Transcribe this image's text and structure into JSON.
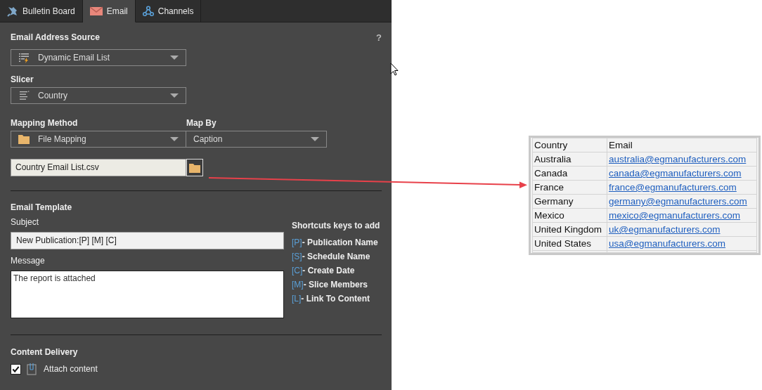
{
  "tabs": [
    {
      "label": "Bulletin Board",
      "selected": false
    },
    {
      "label": "Email",
      "selected": true
    },
    {
      "label": "Channels",
      "selected": false
    }
  ],
  "email_address_source": {
    "label": "Email Address Source",
    "help": "?",
    "value": "Dynamic Email List"
  },
  "slicer": {
    "label": "Slicer",
    "value": "Country"
  },
  "mapping_method": {
    "label": "Mapping Method",
    "value": "File Mapping"
  },
  "map_by": {
    "label": "Map By",
    "value": "Caption"
  },
  "mapping_file": {
    "value": "Country Email List.csv"
  },
  "email_template": {
    "title": "Email Template",
    "subject_label": "Subject",
    "subject": "New Publication:[P] [M] [C]",
    "message_label": "Message",
    "message": "The report is attached"
  },
  "shortcuts": {
    "title": "Shortcuts keys to add",
    "items": [
      {
        "key": "[P]",
        "label": "- Publication Name"
      },
      {
        "key": "[S]",
        "label": "- Schedule Name"
      },
      {
        "key": "[C]",
        "label": "- Create Date"
      },
      {
        "key": "[M]",
        "label": "- Slice Members"
      },
      {
        "key": "[L]",
        "label": "- Link To Content"
      }
    ]
  },
  "content_delivery": {
    "title": "Content Delivery",
    "attach_label": "Attach content",
    "attach_checked": true
  },
  "mapping_table": {
    "columns": [
      "Country",
      "Email"
    ],
    "rows": [
      [
        "Australia",
        "australia@egmanufacturers.com"
      ],
      [
        "Canada",
        "canada@egmanufacturers.com"
      ],
      [
        "France",
        "france@egmanufacturers.com"
      ],
      [
        "Germany",
        "germany@egmanufacturers.com"
      ],
      [
        "Mexico",
        "mexico@egmanufacturers.com"
      ],
      [
        "United Kingdom",
        "uk@egmanufacturers.com"
      ],
      [
        "United States",
        "usa@egmanufacturers.com"
      ]
    ]
  }
}
